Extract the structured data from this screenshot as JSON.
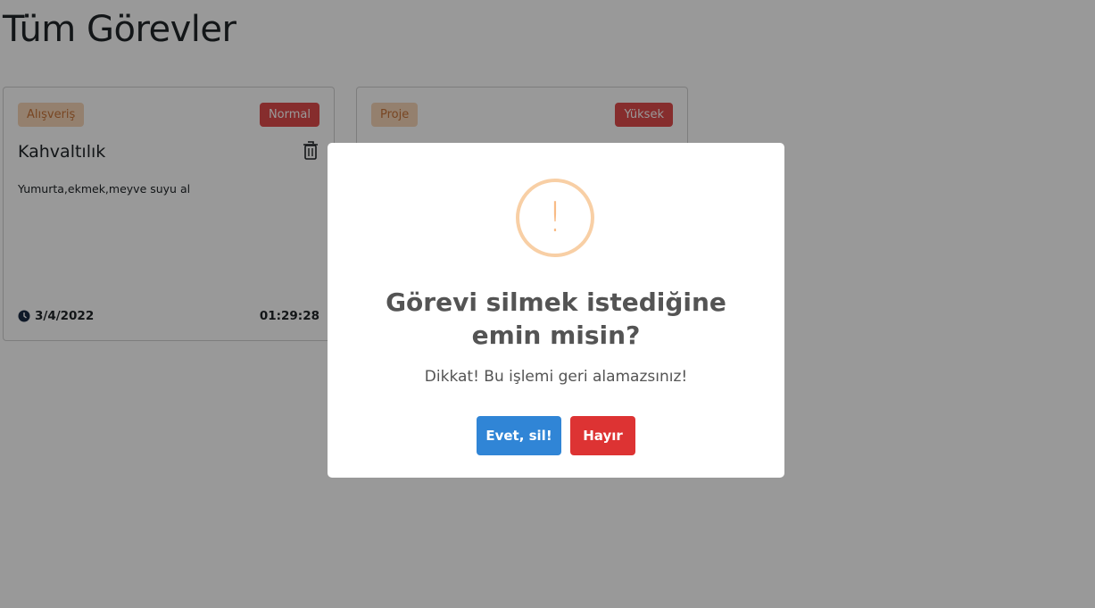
{
  "page": {
    "title": "Tüm Görevler"
  },
  "cards": [
    {
      "category": "Alışveriş",
      "priority": "Normal",
      "title": "Kahvaltılık",
      "description": "Yumurta,ekmek,meyve suyu al",
      "date": "3/4/2022",
      "time": "01:29:28"
    },
    {
      "category": "Proje",
      "priority": "Yüksek"
    }
  ],
  "modal": {
    "icon": "warning-exclamation-icon",
    "icon_glyph": "!",
    "title": "Görevi silmek istediğine emin misin?",
    "text": "Dikkat! Bu işlemi geri alamazsınız!",
    "confirm_label": "Evet, sil!",
    "cancel_label": "Hayır"
  },
  "colors": {
    "confirm": "#3085d6",
    "cancel": "#dd3333",
    "priority_badge": "#e04b4b",
    "category_badge": "#f7d5b7",
    "warning": "#f8bb86"
  }
}
